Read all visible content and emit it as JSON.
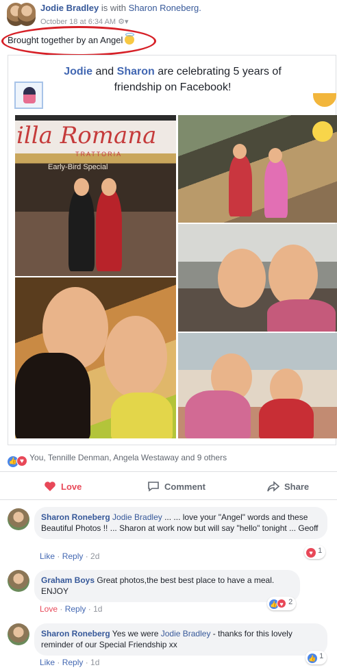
{
  "post": {
    "author": "Jodie Bradley",
    "with_text": "is with",
    "tagged": "Sharon Roneberg.",
    "timestamp": "October 18 at 6:34 AM",
    "text": "Brought together by an Angel"
  },
  "card": {
    "name1": "Jodie",
    "and": "and",
    "name2": "Sharon",
    "rest": "are celebrating 5 years of friendship on Facebook!",
    "photo1_sign": "illa Romana",
    "photo1_sub": "TRATTORIA",
    "photo1_eb": "Early-Bird Special"
  },
  "reactions": {
    "like_icon": "like-icon",
    "love_icon": "love-icon",
    "summary": "You, Tennille Denman, Angela Westaway and 9 others"
  },
  "actions": {
    "love": "Love",
    "comment": "Comment",
    "share": "Share"
  },
  "comments": [
    {
      "author": "Sharon Roneberg",
      "tag": "Jodie Bradley",
      "text": " ... ... love your \"Angel\" words and these Beautiful Photos !! ... Sharon at work now but will say \"hello\" tonight ... Geoff",
      "action1": "Like",
      "action2": "Reply",
      "time": "2d",
      "reaction_count": "1"
    },
    {
      "author": "Graham Boys",
      "tag": "",
      "text": " Great photos,the best best place to have a meal. ENJOY",
      "action1": "Love",
      "action2": "Reply",
      "time": "1d",
      "reaction_count": "2"
    },
    {
      "author": "Sharon Roneberg",
      "tag": "",
      "text1": " Yes we were ",
      "tag2": "Jodie Bradley",
      "text2": " - thanks for this lovely reminder of our Special Friendship xx",
      "action1": "Like",
      "action2": "Reply",
      "time": "1d",
      "reaction_count": "1"
    }
  ],
  "colors": {
    "link": "#365899",
    "love": "#e84858",
    "like": "#4a86e8",
    "highlight_oval": "#d62027"
  }
}
